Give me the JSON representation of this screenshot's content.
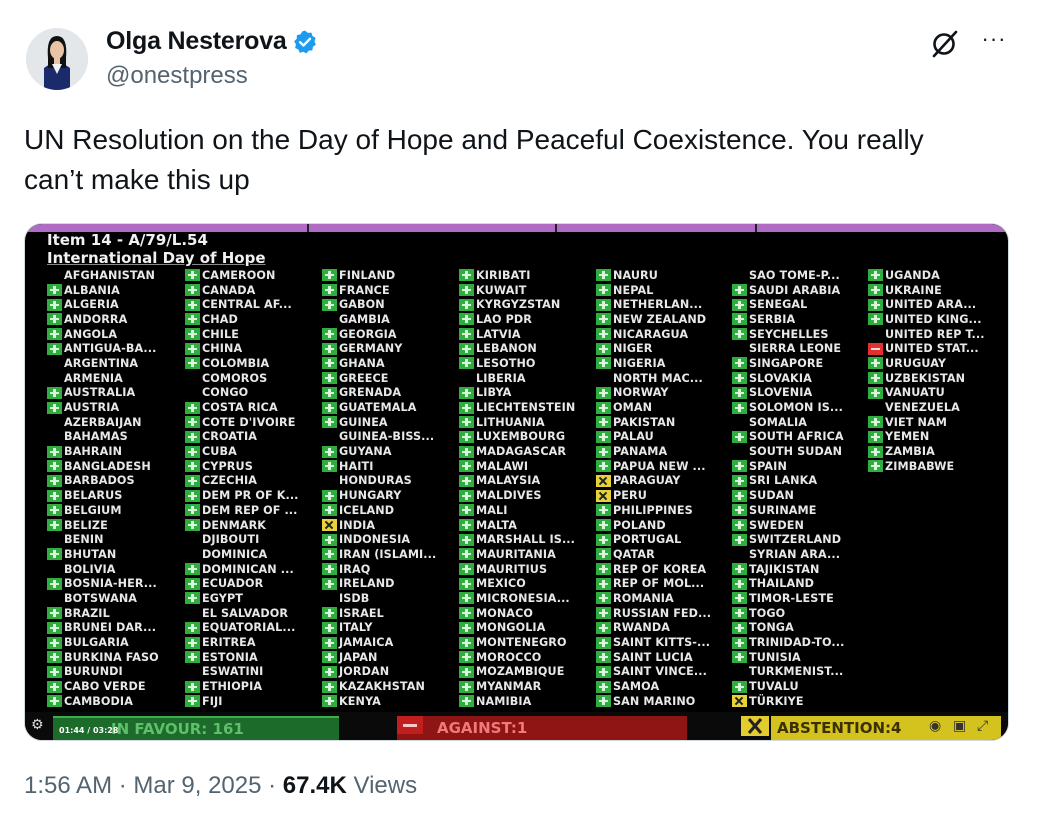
{
  "author": {
    "name": "Olga Nesterova",
    "handle": "@onestpress",
    "verified_color": "#1d9bf0"
  },
  "actions": {
    "grok_icon": "grok-icon",
    "more": "···"
  },
  "tweet": {
    "text_line1": "UN Resolution on the Day of Hope and Peaceful Coexistence. You really",
    "text_line2": "can’t make this up"
  },
  "media": {
    "item": "Item 14 - A/79/L.54",
    "subtitle": "International Day of Hope",
    "colors": {
      "yes": "#2fae3f",
      "no": "#e03030",
      "abstain": "#e8d23a",
      "background": "#000000"
    },
    "columns": [
      [
        [
          "AFGHANISTAN",
          ""
        ],
        [
          "ALBANIA",
          "Y"
        ],
        [
          "ALGERIA",
          "Y"
        ],
        [
          "ANDORRA",
          "Y"
        ],
        [
          "ANGOLA",
          "Y"
        ],
        [
          "ANTIGUA-BA...",
          "Y"
        ],
        [
          "ARGENTINA",
          ""
        ],
        [
          "ARMENIA",
          ""
        ],
        [
          "AUSTRALIA",
          "Y"
        ],
        [
          "AUSTRIA",
          "Y"
        ],
        [
          "AZERBAIJAN",
          ""
        ],
        [
          "BAHAMAS",
          ""
        ],
        [
          "BAHRAIN",
          "Y"
        ],
        [
          "BANGLADESH",
          "Y"
        ],
        [
          "BARBADOS",
          "Y"
        ],
        [
          "BELARUS",
          "Y"
        ],
        [
          "BELGIUM",
          "Y"
        ],
        [
          "BELIZE",
          "Y"
        ],
        [
          "BENIN",
          ""
        ],
        [
          "BHUTAN",
          "Y"
        ],
        [
          "BOLIVIA",
          ""
        ],
        [
          "BOSNIA-HER...",
          "Y"
        ],
        [
          "BOTSWANA",
          ""
        ],
        [
          "BRAZIL",
          "Y"
        ],
        [
          "BRUNEI DAR...",
          "Y"
        ],
        [
          "BULGARIA",
          "Y"
        ],
        [
          "BURKINA FASO",
          "Y"
        ],
        [
          "BURUNDI",
          "Y"
        ],
        [
          "CABO VERDE",
          "Y"
        ],
        [
          "CAMBODIA",
          "Y"
        ]
      ],
      [
        [
          "CAMEROON",
          "Y"
        ],
        [
          "CANADA",
          "Y"
        ],
        [
          "CENTRAL AF...",
          "Y"
        ],
        [
          "CHAD",
          "Y"
        ],
        [
          "CHILE",
          "Y"
        ],
        [
          "CHINA",
          "Y"
        ],
        [
          "COLOMBIA",
          "Y"
        ],
        [
          "COMOROS",
          ""
        ],
        [
          "CONGO",
          ""
        ],
        [
          "COSTA RICA",
          "Y"
        ],
        [
          "COTE D'IVOIRE",
          "Y"
        ],
        [
          "CROATIA",
          "Y"
        ],
        [
          "CUBA",
          "Y"
        ],
        [
          "CYPRUS",
          "Y"
        ],
        [
          "CZECHIA",
          "Y"
        ],
        [
          "DEM PR OF K...",
          "Y"
        ],
        [
          "DEM REP OF ...",
          "Y"
        ],
        [
          "DENMARK",
          "Y"
        ],
        [
          "DJIBOUTI",
          ""
        ],
        [
          "DOMINICA",
          ""
        ],
        [
          "DOMINICAN ...",
          "Y"
        ],
        [
          "ECUADOR",
          "Y"
        ],
        [
          "EGYPT",
          "Y"
        ],
        [
          "EL SALVADOR",
          ""
        ],
        [
          "EQUATORIAL...",
          "Y"
        ],
        [
          "ERITREA",
          "Y"
        ],
        [
          "ESTONIA",
          "Y"
        ],
        [
          "ESWATINI",
          ""
        ],
        [
          "ETHIOPIA",
          "Y"
        ],
        [
          "FIJI",
          "Y"
        ]
      ],
      [
        [
          "FINLAND",
          "Y"
        ],
        [
          "FRANCE",
          "Y"
        ],
        [
          "GABON",
          "Y"
        ],
        [
          "GAMBIA",
          ""
        ],
        [
          "GEORGIA",
          "Y"
        ],
        [
          "GERMANY",
          "Y"
        ],
        [
          "GHANA",
          "Y"
        ],
        [
          "GREECE",
          "Y"
        ],
        [
          "GRENADA",
          "Y"
        ],
        [
          "GUATEMALA",
          "Y"
        ],
        [
          "GUINEA",
          "Y"
        ],
        [
          "GUINEA-BISS...",
          ""
        ],
        [
          "GUYANA",
          "Y"
        ],
        [
          "HAITI",
          "Y"
        ],
        [
          "HONDURAS",
          ""
        ],
        [
          "HUNGARY",
          "Y"
        ],
        [
          "ICELAND",
          "Y"
        ],
        [
          "INDIA",
          "A"
        ],
        [
          "INDONESIA",
          "Y"
        ],
        [
          "IRAN (ISLAMI...",
          "Y"
        ],
        [
          "IRAQ",
          "Y"
        ],
        [
          "IRELAND",
          "Y"
        ],
        [
          "ISDB",
          ""
        ],
        [
          "ISRAEL",
          "Y"
        ],
        [
          "ITALY",
          "Y"
        ],
        [
          "JAMAICA",
          "Y"
        ],
        [
          "JAPAN",
          "Y"
        ],
        [
          "JORDAN",
          "Y"
        ],
        [
          "KAZAKHSTAN",
          "Y"
        ],
        [
          "KENYA",
          "Y"
        ]
      ],
      [
        [
          "KIRIBATI",
          "Y"
        ],
        [
          "KUWAIT",
          "Y"
        ],
        [
          "KYRGYZSTAN",
          "Y"
        ],
        [
          "LAO PDR",
          "Y"
        ],
        [
          "LATVIA",
          "Y"
        ],
        [
          "LEBANON",
          "Y"
        ],
        [
          "LESOTHO",
          "Y"
        ],
        [
          "LIBERIA",
          ""
        ],
        [
          "LIBYA",
          "Y"
        ],
        [
          "LIECHTENSTEIN",
          "Y"
        ],
        [
          "LITHUANIA",
          "Y"
        ],
        [
          "LUXEMBOURG",
          "Y"
        ],
        [
          "MADAGASCAR",
          "Y"
        ],
        [
          "MALAWI",
          "Y"
        ],
        [
          "MALAYSIA",
          "Y"
        ],
        [
          "MALDIVES",
          "Y"
        ],
        [
          "MALI",
          "Y"
        ],
        [
          "MALTA",
          "Y"
        ],
        [
          "MARSHALL IS...",
          "Y"
        ],
        [
          "MAURITANIA",
          "Y"
        ],
        [
          "MAURITIUS",
          "Y"
        ],
        [
          "MEXICO",
          "Y"
        ],
        [
          "MICRONESIA...",
          "Y"
        ],
        [
          "MONACO",
          "Y"
        ],
        [
          "MONGOLIA",
          "Y"
        ],
        [
          "MONTENEGRO",
          "Y"
        ],
        [
          "MOROCCO",
          "Y"
        ],
        [
          "MOZAMBIQUE",
          "Y"
        ],
        [
          "MYANMAR",
          "Y"
        ],
        [
          "NAMIBIA",
          "Y"
        ]
      ],
      [
        [
          "NAURU",
          "Y"
        ],
        [
          "NEPAL",
          "Y"
        ],
        [
          "NETHERLAN...",
          "Y"
        ],
        [
          "NEW ZEALAND",
          "Y"
        ],
        [
          "NICARAGUA",
          "Y"
        ],
        [
          "NIGER",
          "Y"
        ],
        [
          "NIGERIA",
          "Y"
        ],
        [
          "NORTH MAC...",
          ""
        ],
        [
          "NORWAY",
          "Y"
        ],
        [
          "OMAN",
          "Y"
        ],
        [
          "PAKISTAN",
          "Y"
        ],
        [
          "PALAU",
          "Y"
        ],
        [
          "PANAMA",
          "Y"
        ],
        [
          "PAPUA NEW ...",
          "Y"
        ],
        [
          "PARAGUAY",
          "A"
        ],
        [
          "PERU",
          "A"
        ],
        [
          "PHILIPPINES",
          "Y"
        ],
        [
          "POLAND",
          "Y"
        ],
        [
          "PORTUGAL",
          "Y"
        ],
        [
          "QATAR",
          "Y"
        ],
        [
          "REP OF KOREA",
          "Y"
        ],
        [
          "REP OF MOL...",
          "Y"
        ],
        [
          "ROMANIA",
          "Y"
        ],
        [
          "RUSSIAN FED...",
          "Y"
        ],
        [
          "RWANDA",
          "Y"
        ],
        [
          "SAINT KITTS-...",
          "Y"
        ],
        [
          "SAINT LUCIA",
          "Y"
        ],
        [
          "SAINT VINCE...",
          "Y"
        ],
        [
          "SAMOA",
          "Y"
        ],
        [
          "SAN MARINO",
          "Y"
        ]
      ],
      [
        [
          "SAO TOME-P...",
          ""
        ],
        [
          "SAUDI ARABIA",
          "Y"
        ],
        [
          "SENEGAL",
          "Y"
        ],
        [
          "SERBIA",
          "Y"
        ],
        [
          "SEYCHELLES",
          "Y"
        ],
        [
          "SIERRA LEONE",
          ""
        ],
        [
          "SINGAPORE",
          "Y"
        ],
        [
          "SLOVAKIA",
          "Y"
        ],
        [
          "SLOVENIA",
          "Y"
        ],
        [
          "SOLOMON IS...",
          "Y"
        ],
        [
          "SOMALIA",
          ""
        ],
        [
          "SOUTH AFRICA",
          "Y"
        ],
        [
          "SOUTH SUDAN",
          ""
        ],
        [
          "SPAIN",
          "Y"
        ],
        [
          "SRI LANKA",
          "Y"
        ],
        [
          "SUDAN",
          "Y"
        ],
        [
          "SURINAME",
          "Y"
        ],
        [
          "SWEDEN",
          "Y"
        ],
        [
          "SWITZERLAND",
          "Y"
        ],
        [
          "SYRIAN ARA...",
          ""
        ],
        [
          "TAJIKISTAN",
          "Y"
        ],
        [
          "THAILAND",
          "Y"
        ],
        [
          "TIMOR-LESTE",
          "Y"
        ],
        [
          "TOGO",
          "Y"
        ],
        [
          "TONGA",
          "Y"
        ],
        [
          "TRINIDAD-TO...",
          "Y"
        ],
        [
          "TUNISIA",
          "Y"
        ],
        [
          "TURKMENIST...",
          ""
        ],
        [
          "TUVALU",
          "Y"
        ],
        [
          "TÜRKIYE",
          "A"
        ]
      ],
      [
        [
          "UGANDA",
          "Y"
        ],
        [
          "UKRAINE",
          "Y"
        ],
        [
          "UNITED ARA...",
          "Y"
        ],
        [
          "UNITED KING...",
          "Y"
        ],
        [
          "UNITED REP T...",
          ""
        ],
        [
          "UNITED STAT...",
          "N"
        ],
        [
          "URUGUAY",
          "Y"
        ],
        [
          "UZBEKISTAN",
          "Y"
        ],
        [
          "VANUATU",
          "Y"
        ],
        [
          "VENEZUELA",
          ""
        ],
        [
          "VIET NAM",
          "Y"
        ],
        [
          "YEMEN",
          "Y"
        ],
        [
          "ZAMBIA",
          "Y"
        ],
        [
          "ZIMBABWE",
          "Y"
        ]
      ]
    ],
    "totals": {
      "favour": "IN FAVOUR: 161",
      "against": "AGAINST:1",
      "abstention": "ABSTENTION:4",
      "timecode": "01:44 / 03:28"
    }
  },
  "meta": {
    "time": "1:56 AM",
    "sep1": " · ",
    "date": "Mar 9, 2025",
    "sep2": " · ",
    "views_count": "67.4K",
    "views_label": " Views"
  }
}
